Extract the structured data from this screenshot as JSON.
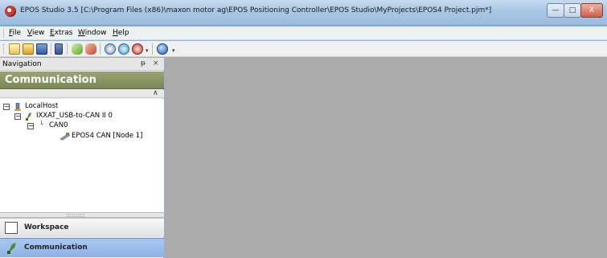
{
  "window": {
    "title": "EPOS Studio 3.5 [C:\\Program Files (x86)\\maxon motor ag\\EPOS Positioning Controller\\EPOS Studio\\MyProjects\\EPOS4 Project.pjm*]",
    "minimize_symbol": "—",
    "maximize_symbol": "□",
    "close_symbol": "X"
  },
  "menu": {
    "items": [
      {
        "underline": "F",
        "rest": "ile"
      },
      {
        "underline": "V",
        "rest": "iew"
      },
      {
        "underline": "E",
        "rest": "xtras"
      },
      {
        "underline": "W",
        "rest": "indow"
      },
      {
        "underline": "H",
        "rest": "elp"
      }
    ]
  },
  "toolbar": {
    "icons": [
      "new-icon",
      "open-icon",
      "save-icon",
      "device-icon",
      "green-wrench-icon",
      "red-wrench-icon",
      "wizard-icon",
      "regulation-icon",
      "diagnostics-icon",
      "help-icon"
    ],
    "overflow_symbol": "▾"
  },
  "navigation": {
    "title": "Navigation",
    "pin_symbol": "ᵽ",
    "close_symbol": "×",
    "section_title": "Communication",
    "collapse_symbol": "≈",
    "tree": {
      "root": {
        "expander": "−",
        "label": "LocalHost"
      },
      "interface": {
        "expander": "−",
        "label": "IXXAT_USB-to-CAN II 0"
      },
      "channel": {
        "expander": "−",
        "connector": "└",
        "label": "CAN0"
      },
      "node": {
        "label": "EPOS4 CAN [Node 1]"
      }
    },
    "splitter_dots": "::::::::::",
    "buttons": [
      {
        "label": "Workspace"
      },
      {
        "label": "Communication"
      }
    ]
  },
  "colors": {
    "section_header": "#86915f",
    "selected_button": "#9bbdea",
    "workarea": "#ababab"
  }
}
